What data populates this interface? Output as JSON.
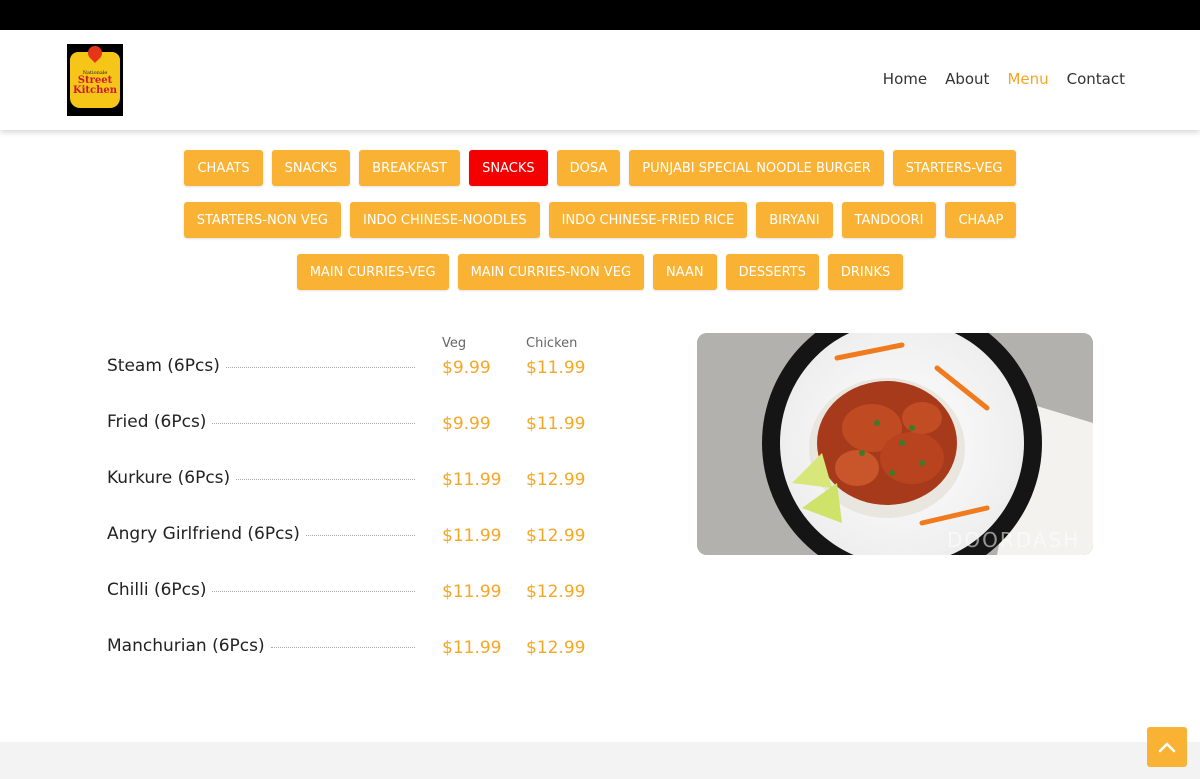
{
  "header": {
    "logo": {
      "top": "Nationale",
      "line1": "Street",
      "line2": "Kitchen"
    },
    "nav": [
      {
        "label": "Home"
      },
      {
        "label": "About"
      },
      {
        "label": "Menu"
      },
      {
        "label": "Contact"
      }
    ],
    "active_nav": "Menu"
  },
  "tabs": {
    "row1": [
      "CHAATS",
      "SNACKS",
      "BREAKFAST",
      "SNACKS",
      "DOSA",
      "PUNJABI SPECIAL NOODLE BURGER",
      "STARTERS-VEG"
    ],
    "row2": [
      "STARTERS-NON VEG",
      "INDO CHINESE-NOODLES",
      "INDO CHINESE-FRIED RICE",
      "BIRYANI",
      "TANDOORI",
      "CHAAP"
    ],
    "row3": [
      "MAIN CURRIES-VEG",
      "MAIN CURRIES-NON VEG",
      "NAAN",
      "DESSERTS",
      "DRINKS"
    ],
    "active_index": 3
  },
  "menu": {
    "columns": [
      "Veg",
      "Chicken"
    ],
    "items": [
      {
        "name": "Steam (6Pcs)",
        "veg": "$9.99",
        "chicken": "$11.99"
      },
      {
        "name": "Fried (6Pcs)",
        "veg": "$9.99",
        "chicken": "$11.99"
      },
      {
        "name": "Kurkure (6Pcs)",
        "veg": "$11.99",
        "chicken": "$12.99"
      },
      {
        "name": "Angry Girlfriend (6Pcs)",
        "veg": "$11.99",
        "chicken": "$12.99"
      },
      {
        "name": "Chilli (6Pcs)",
        "veg": "$11.99",
        "chicken": "$12.99"
      },
      {
        "name": "Manchurian (6Pcs)",
        "veg": "$11.99",
        "chicken": "$12.99"
      }
    ]
  },
  "photo": {
    "watermark": "DOORDASH"
  },
  "colors": {
    "accent": "#f9b233",
    "active_tab": "#f50000",
    "price": "#f5a623",
    "nav_active": "#f5a623"
  },
  "icons": {
    "scroll_top": "chevron-up-icon"
  }
}
